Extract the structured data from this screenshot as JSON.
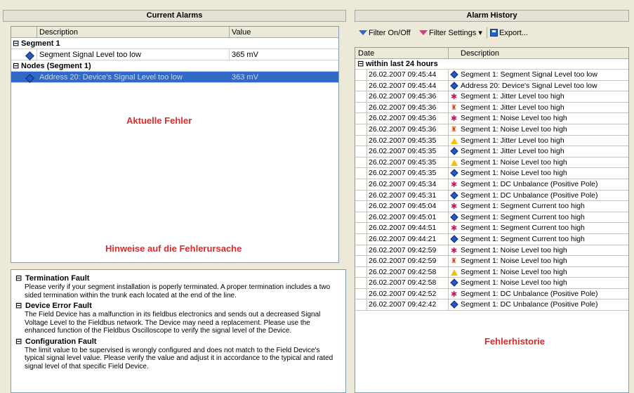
{
  "current_alarms": {
    "title": "Current Alarms",
    "columns": {
      "description": "Description",
      "value": "Value"
    },
    "groups": [
      {
        "name": "Segment 1",
        "items": [
          {
            "icon": "info-diamond-icon",
            "description": "Segment Signal Level too low",
            "value": "365 mV",
            "selected": false
          }
        ]
      },
      {
        "name": "Nodes (Segment 1)",
        "items": [
          {
            "icon": "info-diamond-icon",
            "description": "Address 20: Device's Signal Level too low",
            "value": "363 mV",
            "selected": true
          }
        ]
      }
    ]
  },
  "overlays": {
    "current_errors": "Aktuelle Fehler",
    "error_hints": "Hinweise auf die Fehlerursache",
    "error_history": "Fehlerhistorie"
  },
  "hints": [
    {
      "title": "Termination Fault",
      "text": "Please verify if your segment installation is poperly terminated. A proper termination includes a two sided termination within the trunk each located at the end of the line."
    },
    {
      "title": "Device Error Fault",
      "text": "The Field Device has a malfunction in its fieldbus electronics and sends out a decreased Signal Voltage Level to the Fieldbus network. The Device may need a replacement. Please use the enhanced function of the Fieldbus Oscilloscope to verify the signal level of the Device."
    },
    {
      "title": "Configuration Fault",
      "text": "The limit value to be supervised is wrongly configured and does not match to the Field Device's typical signal level value. Please verify the value and adjust it in accordance to the typical and rated signal level of that specific Field Device."
    }
  ],
  "alarm_history": {
    "title": "Alarm History",
    "toolbar": {
      "filter_toggle": "Filter On/Off",
      "filter_settings": "Filter Settings",
      "export": "Export..."
    },
    "columns": {
      "date": "Date",
      "description": "Description"
    },
    "group": "within last 24 hours",
    "rows": [
      {
        "date": "26.02.2007 09:45:44",
        "icon": "info-diamond-icon",
        "text": "Segment 1: Segment Signal Level too low"
      },
      {
        "date": "26.02.2007 09:45:44",
        "icon": "info-diamond-icon",
        "text": "Address 20: Device's Signal Level too low"
      },
      {
        "date": "26.02.2007 09:45:36",
        "icon": "error-star-icon",
        "text": "Segment 1: Jitter Level too high"
      },
      {
        "date": "26.02.2007 09:45:36",
        "icon": "alarm-bell-icon",
        "text": "Segment 1: Jitter Level too high"
      },
      {
        "date": "26.02.2007 09:45:36",
        "icon": "error-star-icon",
        "text": "Segment 1: Noise Level too high"
      },
      {
        "date": "26.02.2007 09:45:36",
        "icon": "alarm-bell-icon",
        "text": "Segment 1: Noise Level too high"
      },
      {
        "date": "26.02.2007 09:45:35",
        "icon": "warning-triangle-icon",
        "text": "Segment 1: Jitter Level too high"
      },
      {
        "date": "26.02.2007 09:45:35",
        "icon": "info-diamond-icon",
        "text": "Segment 1: Jitter Level too high"
      },
      {
        "date": "26.02.2007 09:45:35",
        "icon": "warning-triangle-icon",
        "text": "Segment 1: Noise Level too high"
      },
      {
        "date": "26.02.2007 09:45:35",
        "icon": "info-diamond-icon",
        "text": "Segment 1: Noise Level too high"
      },
      {
        "date": "26.02.2007 09:45:34",
        "icon": "error-star-icon",
        "text": "Segment 1: DC Unbalance (Positive Pole)"
      },
      {
        "date": "26.02.2007 09:45:31",
        "icon": "info-diamond-icon",
        "text": "Segment 1: DC Unbalance (Positive Pole)"
      },
      {
        "date": "26.02.2007 09:45:04",
        "icon": "error-star-icon",
        "text": "Segment 1: Segment Current too high"
      },
      {
        "date": "26.02.2007 09:45:01",
        "icon": "info-diamond-icon",
        "text": "Segment 1: Segment Current too high"
      },
      {
        "date": "26.02.2007 09:44:51",
        "icon": "error-star-icon",
        "text": "Segment 1: Segment Current too high"
      },
      {
        "date": "26.02.2007 09:44:21",
        "icon": "info-diamond-icon",
        "text": "Segment 1: Segment Current too high"
      },
      {
        "date": "26.02.2007 09:42:59",
        "icon": "error-star-icon",
        "text": "Segment 1: Noise Level too high"
      },
      {
        "date": "26.02.2007 09:42:59",
        "icon": "alarm-bell-icon",
        "text": "Segment 1: Noise Level too high"
      },
      {
        "date": "26.02.2007 09:42:58",
        "icon": "warning-triangle-icon",
        "text": "Segment 1: Noise Level too high"
      },
      {
        "date": "26.02.2007 09:42:58",
        "icon": "info-diamond-icon",
        "text": "Segment 1: Noise Level too high"
      },
      {
        "date": "26.02.2007 09:42:52",
        "icon": "error-star-icon",
        "text": "Segment 1: DC Unbalance (Positive Pole)"
      },
      {
        "date": "26.02.2007 09:42:42",
        "icon": "info-diamond-icon",
        "text": "Segment 1: DC Unbalance (Positive Pole)"
      }
    ]
  },
  "colors": {
    "selection": "#3169c6",
    "overlay_text": "#e0282a",
    "info_icon": "#2a58c2",
    "error_icon": "#c2185b",
    "warning_icon": "#f2c200"
  }
}
